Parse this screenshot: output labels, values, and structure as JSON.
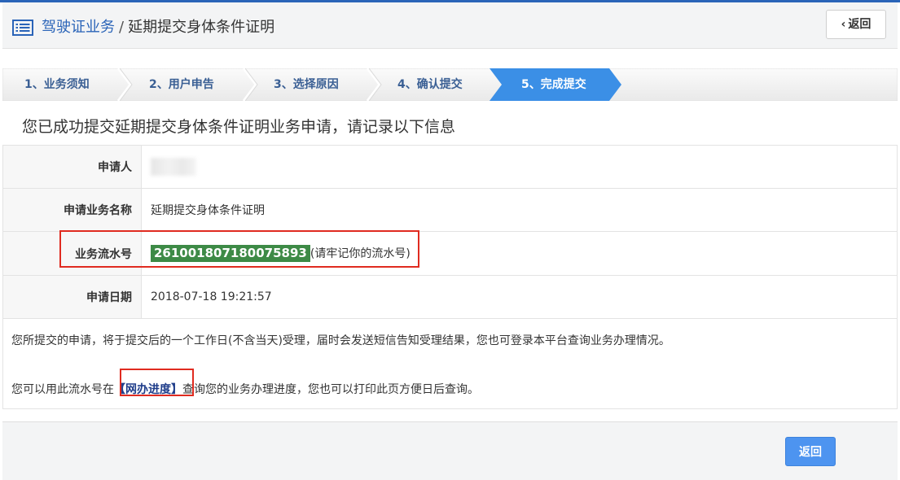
{
  "header": {
    "breadcrumb_root": "驾驶证业务",
    "breadcrumb_sep": "/",
    "breadcrumb_current": "延期提交身体条件证明",
    "back_label": "返回",
    "accent_color": "#2a64b8"
  },
  "steps": [
    {
      "label": "1、业务须知",
      "active": false
    },
    {
      "label": "2、用户申告",
      "active": false
    },
    {
      "label": "3、选择原因",
      "active": false
    },
    {
      "label": "4、确认提交",
      "active": false
    },
    {
      "label": "5、完成提交",
      "active": true
    }
  ],
  "notice": "您已成功提交延期提交身体条件证明业务申请，请记录以下信息",
  "info": {
    "applicant_label": "申请人",
    "business_name_label": "申请业务名称",
    "business_name_value": "延期提交身体条件证明",
    "serial_label": "业务流水号",
    "serial_value": "261001807180075893",
    "serial_hint": "(请牢记你的流水号)",
    "date_label": "申请日期",
    "date_value": "2018-07-18 19:21:57"
  },
  "note": {
    "line1": "您所提交的申请，将于提交后的一个工作日(不含当天)受理，届时会发送短信告知受理结果，您也可登录本平台查询业务办理情况。",
    "line2_prefix": "您可以用此流水号在",
    "line2_link": "【网办进度】",
    "line2_suffix": "查询您的业务办理进度，您也可以打印此页方便日后查询。"
  },
  "footer": {
    "back_label": "返回",
    "button_color": "#4d94f0"
  }
}
